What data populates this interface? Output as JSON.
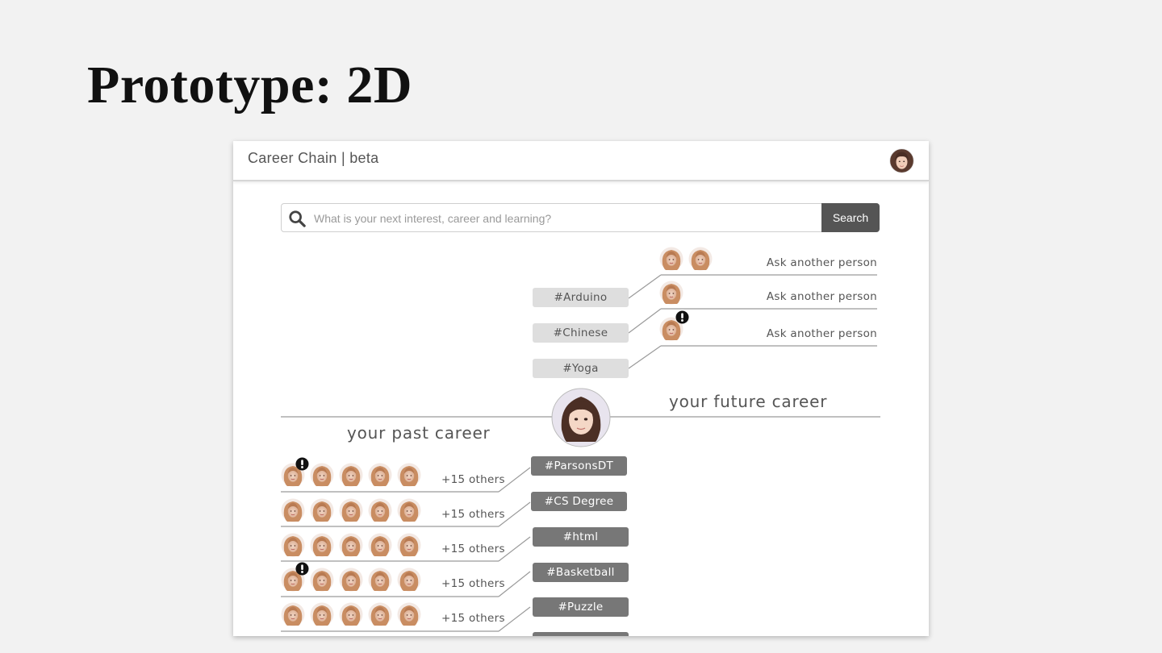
{
  "slide": {
    "title": "Prototype: 2D"
  },
  "app": {
    "brand": "Career Chain | beta",
    "search": {
      "placeholder": "What is your next interest, career and learning?",
      "value": "",
      "button_label": "Search"
    }
  },
  "future": {
    "label": "your future career",
    "ask_rows": [
      {
        "text": "Ask another person",
        "avatars": 2,
        "alert": false
      },
      {
        "text": "Ask another person",
        "avatars": 1,
        "alert": false
      },
      {
        "text": "Ask another person",
        "avatars": 1,
        "alert": true
      }
    ],
    "tags": [
      "#Arduino",
      "#Chinese",
      "#Yoga"
    ]
  },
  "past": {
    "label": "your past career",
    "rows": [
      {
        "tag": "#ParsonsDT",
        "others": "+15 others",
        "alert": true
      },
      {
        "tag": "#CS Degree",
        "others": "+15 others",
        "alert": false
      },
      {
        "tag": "#html",
        "others": "+15 others",
        "alert": false
      },
      {
        "tag": "#Basketball",
        "others": "+15 others",
        "alert": true
      },
      {
        "tag": "#Puzzle",
        "others": "+15 others",
        "alert": false
      }
    ]
  },
  "icons": {
    "search": "search-icon",
    "avatar": "user-avatar",
    "alert": "exclamation-alert-icon"
  },
  "colors": {
    "light_tag": "#dedede",
    "dark_tag": "#777777",
    "search_button": "#555555",
    "line": "#9a9a9a"
  }
}
